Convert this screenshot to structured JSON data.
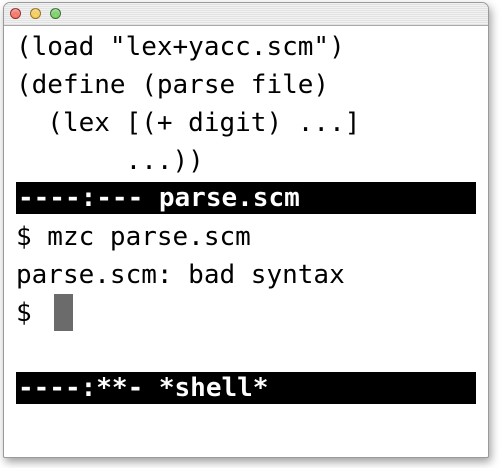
{
  "window": {
    "controls": [
      "close-button",
      "minimize-button",
      "zoom-button"
    ]
  },
  "editor": {
    "lines": [
      "(load \"lex+yacc.scm\")",
      "(define (parse file)",
      "  (lex [(+ digit) ...]",
      "       ...))"
    ],
    "modeline": "----:--- parse.scm"
  },
  "shell": {
    "lines": [
      "$ mzc parse.scm",
      "parse.scm: bad syntax",
      "$ "
    ],
    "modeline": "----:**- *shell*"
  },
  "colors": {
    "background": "#ffffff",
    "text": "#000000",
    "modeline_background": "#000000",
    "modeline_text": "#ffffff",
    "cursor": "#6b6b6b"
  }
}
